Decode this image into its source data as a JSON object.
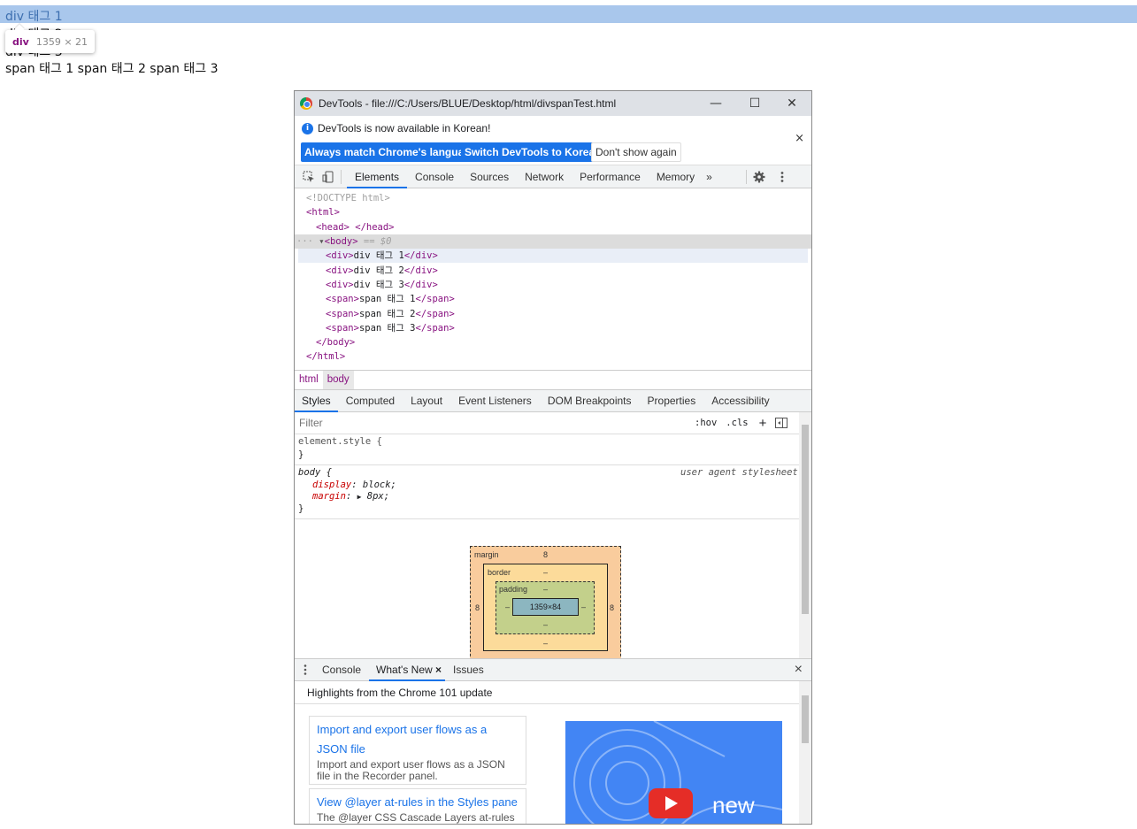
{
  "page": {
    "lines": [
      "div 태그 1",
      "div 태그 2",
      "div 태그 3",
      "span 태그 1 span 태그 2 span 태그 3"
    ],
    "tooltip": {
      "tag": "div",
      "size": "1359 × 21"
    }
  },
  "devtools": {
    "window_title": "DevTools - file:///C:/Users/BLUE/Desktop/html/divspanTest.html",
    "window_buttons": {
      "minimize": "—",
      "maximize": "☐",
      "close": "✕"
    },
    "infobar": {
      "message": "DevTools is now available in Korean!",
      "btn_match": "Always match Chrome's language",
      "btn_switch": "Switch DevTools to Korean",
      "btn_dont": "Don't show again",
      "close": "×"
    },
    "main_tabs": [
      "Elements",
      "Console",
      "Sources",
      "Network",
      "Performance",
      "Memory"
    ],
    "more_tabs": "»",
    "dom": {
      "doctype": "<!DOCTYPE html>",
      "html_open": "<html>",
      "head": "<head> </head>",
      "body_open": "<body>",
      "body_marker": " == $0",
      "ellipsis": "···",
      "body_children": [
        {
          "open": "<div>",
          "text": "div 태그 1",
          "close": "</div>"
        },
        {
          "open": "<div>",
          "text": "div 태그 2",
          "close": "</div>"
        },
        {
          "open": "<div>",
          "text": "div 태그 3",
          "close": "</div>"
        },
        {
          "open": "<span>",
          "text": "span 태그 1",
          "close": "</span>"
        },
        {
          "open": "<span>",
          "text": "span 태그 2",
          "close": "</span>"
        },
        {
          "open": "<span>",
          "text": "span 태그 3",
          "close": "</span>"
        }
      ],
      "body_close": "</body>",
      "html_close": "</html>"
    },
    "breadcrumbs": [
      "html",
      "body"
    ],
    "style_tabs": [
      "Styles",
      "Computed",
      "Layout",
      "Event Listeners",
      "DOM Breakpoints",
      "Properties",
      "Accessibility"
    ],
    "filter": {
      "placeholder": "Filter",
      "hov": ":hov",
      "cls": ".cls",
      "plus": "+"
    },
    "rules": {
      "element_style": "element.style {",
      "close_brace": "}",
      "body_selector": "body {",
      "source": "user agent stylesheet",
      "display_prop": "display",
      "display_val": "block;",
      "margin_prop": "margin",
      "margin_val": "8px;"
    },
    "box_model": {
      "margin_label": "margin",
      "margin_val": "8",
      "border_label": "border",
      "border_val": "–",
      "padding_label": "padding",
      "padding_val": "–",
      "content": "1359×84",
      "side_left": "8",
      "side_right": "8",
      "dash": "–"
    },
    "drawer": {
      "tabs": [
        "Console",
        "What's New",
        "Issues"
      ],
      "tab_close": "×",
      "close": "×",
      "highlights": "Highlights from the Chrome 101 update",
      "cards": [
        {
          "title_line1": "Import and export user flows as a",
          "title_line2": "JSON file",
          "desc_line1": "Import and export user flows as a JSON",
          "desc_line2": "file in the Recorder panel."
        },
        {
          "title_line1": "View @layer at-rules in the Styles pane",
          "desc_line1": "The @layer CSS Cascade Layers at-rules"
        }
      ],
      "video_text": "new"
    }
  },
  "colors": {
    "accent": "#1a73e8",
    "highlight": "#a9c7ec",
    "tag": "#881280",
    "margin_box": "#f9cc9d",
    "border_box": "#fcdb9a",
    "padding_box": "#c3d08b",
    "content_box": "#8cb6c0"
  }
}
